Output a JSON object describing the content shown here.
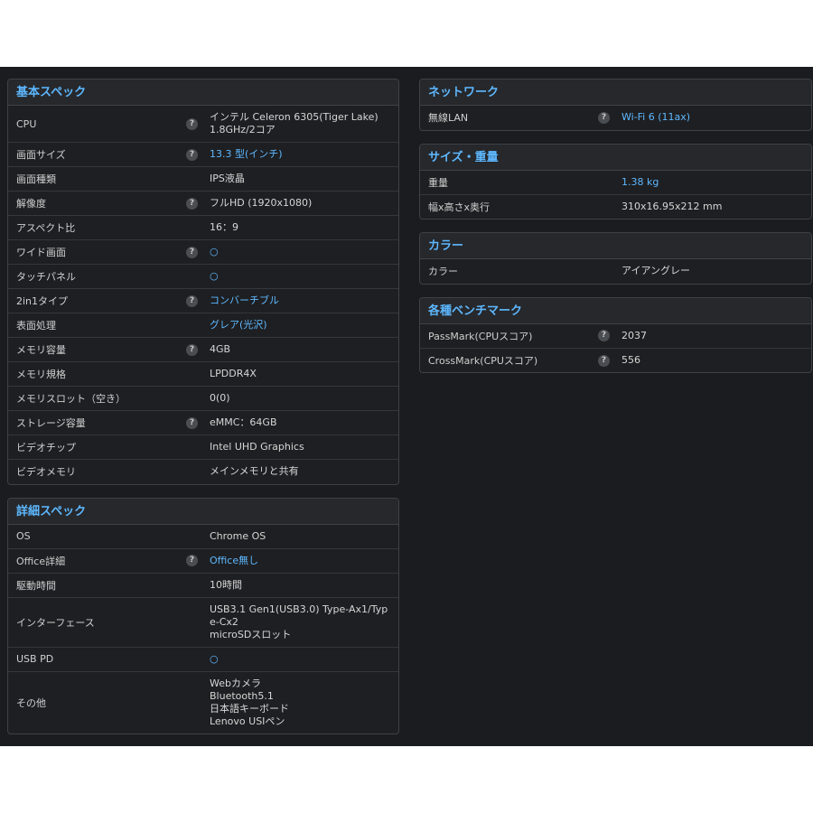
{
  "sections_left": [
    {
      "title": "基本スペック",
      "rows": [
        {
          "label": "CPU",
          "help": true,
          "value": "インテル Celeron 6305(Tiger Lake)\n1.8GHz/2コア",
          "link": false
        },
        {
          "label": "画面サイズ",
          "help": true,
          "value": "13.3 型(インチ)",
          "link": true
        },
        {
          "label": "画面種類",
          "help": false,
          "value": "IPS液晶",
          "link": false
        },
        {
          "label": "解像度",
          "help": true,
          "value": "フルHD (1920x1080)",
          "link": false
        },
        {
          "label": "アスペクト比",
          "help": false,
          "value": "16：9",
          "link": false
        },
        {
          "label": "ワイド画面",
          "help": true,
          "value": "○",
          "link": true
        },
        {
          "label": "タッチパネル",
          "help": false,
          "value": "○",
          "link": true
        },
        {
          "label": "2in1タイプ",
          "help": true,
          "value": "コンバーチブル",
          "link": true
        },
        {
          "label": "表面処理",
          "help": false,
          "value": "グレア(光沢)",
          "link": true
        },
        {
          "label": "メモリ容量",
          "help": true,
          "value": "4GB",
          "link": false
        },
        {
          "label": "メモリ規格",
          "help": false,
          "value": "LPDDR4X",
          "link": false
        },
        {
          "label": "メモリスロット（空き）",
          "help": false,
          "value": "0(0)",
          "link": false
        },
        {
          "label": "ストレージ容量",
          "help": true,
          "value": "eMMC：64GB",
          "link": false
        },
        {
          "label": "ビデオチップ",
          "help": false,
          "value": "Intel UHD Graphics",
          "link": false
        },
        {
          "label": "ビデオメモリ",
          "help": false,
          "value": "メインメモリと共有",
          "link": false
        }
      ]
    },
    {
      "title": "詳細スペック",
      "rows": [
        {
          "label": "OS",
          "help": false,
          "value": "Chrome OS",
          "link": false
        },
        {
          "label": "Office詳細",
          "help": true,
          "value": "Office無し",
          "link": true
        },
        {
          "label": "駆動時間",
          "help": false,
          "value": "10時間",
          "link": false
        },
        {
          "label": "インターフェース",
          "help": false,
          "value": "USB3.1 Gen1(USB3.0) Type-Ax1/Typ\ne-Cx2\nmicroSDスロット",
          "link": false
        },
        {
          "label": "USB PD",
          "help": false,
          "value": "○",
          "link": true
        },
        {
          "label": "その他",
          "help": false,
          "value": "Webカメラ\nBluetooth5.1\n日本語キーボード\nLenovo USIペン",
          "link": false
        }
      ]
    }
  ],
  "sections_right": [
    {
      "title": "ネットワーク",
      "rows": [
        {
          "label": "無線LAN",
          "help": true,
          "value": "Wi-Fi 6 (11ax)",
          "link": true
        }
      ]
    },
    {
      "title": "サイズ・重量",
      "rows": [
        {
          "label": "重量",
          "help": false,
          "value": "1.38 kg",
          "link": true
        },
        {
          "label": "幅x高さx奥行",
          "help": false,
          "value": "310x16.95x212 mm",
          "link": false
        }
      ]
    },
    {
      "title": "カラー",
      "rows": [
        {
          "label": "カラー",
          "help": false,
          "value": "アイアングレー",
          "link": false
        }
      ]
    },
    {
      "title": "各種ベンチマーク",
      "rows": [
        {
          "label": "PassMark(CPUスコア)",
          "help": true,
          "value": "2037",
          "link": false
        },
        {
          "label": "CrossMark(CPUスコア)",
          "help": true,
          "value": "556",
          "link": false
        }
      ]
    }
  ],
  "help_glyph": "?",
  "colors": {
    "accent": "#5eb8ff",
    "background": "#1b1c1f",
    "panel_header": "#26282c"
  }
}
